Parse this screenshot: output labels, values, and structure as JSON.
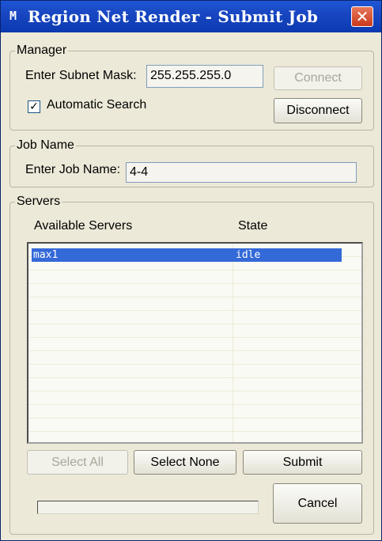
{
  "window": {
    "title": "Region Net Render - Submit Job",
    "icon": "app-logo-icon",
    "icon_glyph": "M",
    "close_glyph": "✕"
  },
  "manager": {
    "legend": "Manager",
    "subnet_label": "Enter Subnet Mask:",
    "subnet_value": "255.255.255.0",
    "connect_label": "Connect",
    "disconnect_label": "Disconnect",
    "auto_search_label": "Automatic Search",
    "auto_search_checked": true,
    "check_glyph": "✓"
  },
  "job": {
    "legend": "Job Name",
    "label": "Enter Job Name:",
    "value": "4-4"
  },
  "servers": {
    "legend": "Servers",
    "columns": [
      "Available Servers",
      "State"
    ],
    "rows": [
      {
        "name": "max1",
        "state": "idle",
        "selected": true
      }
    ]
  },
  "buttons": {
    "select_all": "Select All",
    "select_none": "Select None",
    "submit": "Submit",
    "cancel": "Cancel"
  },
  "progress": {
    "value": 0
  },
  "colors": {
    "title_bar": "#0a39b0",
    "selection": "#3469d8",
    "close": "#c9391c"
  }
}
